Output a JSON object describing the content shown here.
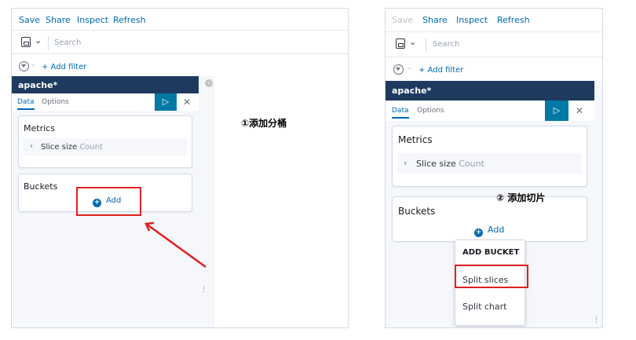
{
  "left": {
    "toolbar": {
      "save": "Save",
      "share": "Share",
      "inspect": "Inspect",
      "refresh": "Refresh"
    },
    "search": {
      "placeholder": "Search"
    },
    "filter": {
      "dash": "-",
      "add_filter": "+ Add filter"
    },
    "sidebar": {
      "title": "apache*",
      "tabs": [
        "Data",
        "Options"
      ],
      "metrics": {
        "title": "Metrics",
        "agg_label": "Slice size",
        "agg_value": "Count"
      },
      "buckets": {
        "title": "Buckets",
        "add_label": "Add"
      }
    },
    "annotation": "①添加分桶"
  },
  "right": {
    "toolbar": {
      "save": "Save",
      "share": "Share",
      "inspect": "Inspect",
      "refresh": "Refresh"
    },
    "search": {
      "placeholder": "Search"
    },
    "filter": {
      "dash": "-",
      "add_filter": "+ Add filter"
    },
    "sidebar": {
      "title": "apache*",
      "tabs": [
        "Data",
        "Options"
      ],
      "metrics": {
        "title": "Metrics",
        "agg_label": "Slice size",
        "agg_value": "Count"
      },
      "buckets": {
        "title": "Buckets",
        "add_label": "Add"
      }
    },
    "popover": {
      "title": "ADD BUCKET",
      "items": [
        "Split slices",
        "Split chart"
      ]
    },
    "annotation": "② 添加切片"
  },
  "colors": {
    "accent": "#006bb4",
    "header": "#1e3a5f",
    "highlight": "#e02020"
  }
}
